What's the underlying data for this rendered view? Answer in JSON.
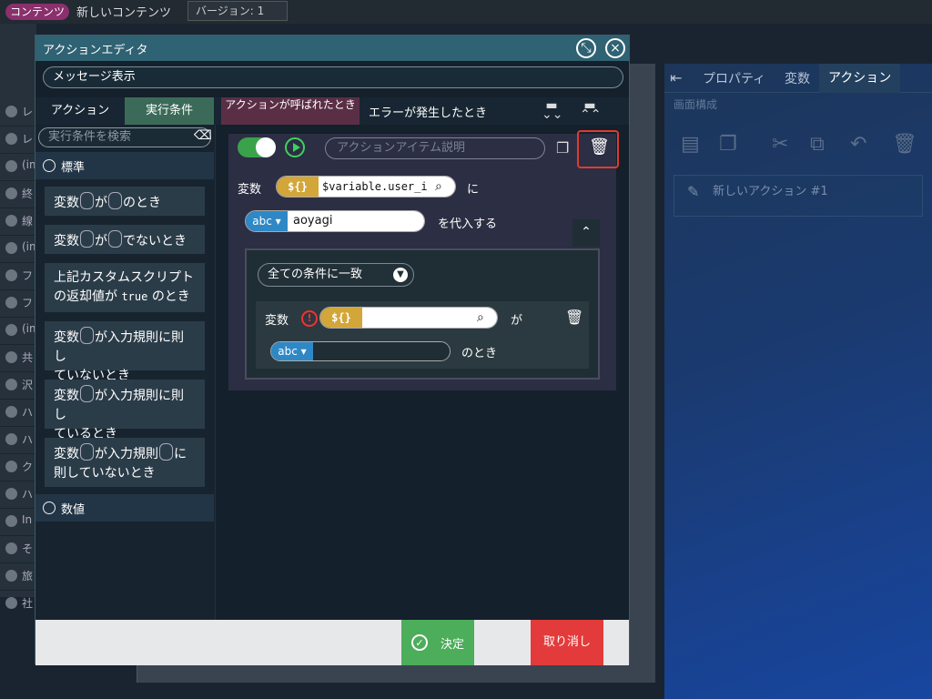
{
  "topbar": {
    "badge": "コンテンツ",
    "title": "新しいコンテンツ",
    "version": "バージョン: 1"
  },
  "background": {
    "left_rows": [
      "レ",
      "レ",
      "(im",
      "終",
      "線",
      "(im",
      "フ",
      "フ",
      "(im",
      "共",
      "沢",
      "ハ",
      "ハ",
      "ク",
      "ハ",
      "In",
      "そ",
      "旅",
      "社"
    ],
    "panel_tabs": [
      "プロパティ",
      "変数",
      "アクション"
    ],
    "section": "画面構成",
    "new_action": "新しいアクション #1"
  },
  "dialog": {
    "title": "アクションエディタ",
    "name_value": "メッセージ表示",
    "left_tabs": [
      "アクション",
      "実行条件"
    ],
    "event_tabs": [
      "アクションが呼ばれたとき",
      "エラーが発生したとき"
    ],
    "search_placeholder": "実行条件を検索",
    "categories": [
      "標準",
      "数値"
    ],
    "items": [
      {
        "a": "変数",
        "b": "が",
        "c": "のとき"
      },
      {
        "a": "変数",
        "b": "が",
        "c": "でないとき"
      },
      {
        "line1": "上記カスタムスクリプト",
        "line2a": "の返却値が",
        "code": "true",
        "line2b": "のとき"
      },
      {
        "a": "変数",
        "b": "が入力規則に則し",
        "c": "ていないとき"
      },
      {
        "a": "変数",
        "b": "が入力規則に則し",
        "c": "ているとき"
      },
      {
        "a": "変数",
        "b": "が入力規則",
        "c": "に",
        "d": "則していないとき"
      }
    ],
    "editor": {
      "desc_placeholder": "アクションアイテム説明",
      "var_label": "変数",
      "var_token": "${}",
      "var_value": "$variable.user_i",
      "ni": "に",
      "type_label": "abc",
      "assign_value": "aoyagi",
      "assign_suffix": "を代入する",
      "cond_select": "全ての条件に一致",
      "cond_var_label": "変数",
      "cond_token": "${}",
      "cond_ga": "が",
      "cond_type": "abc",
      "cond_suffix": "のとき"
    },
    "ok_label": "決定",
    "cancel_label": "取り消し"
  }
}
